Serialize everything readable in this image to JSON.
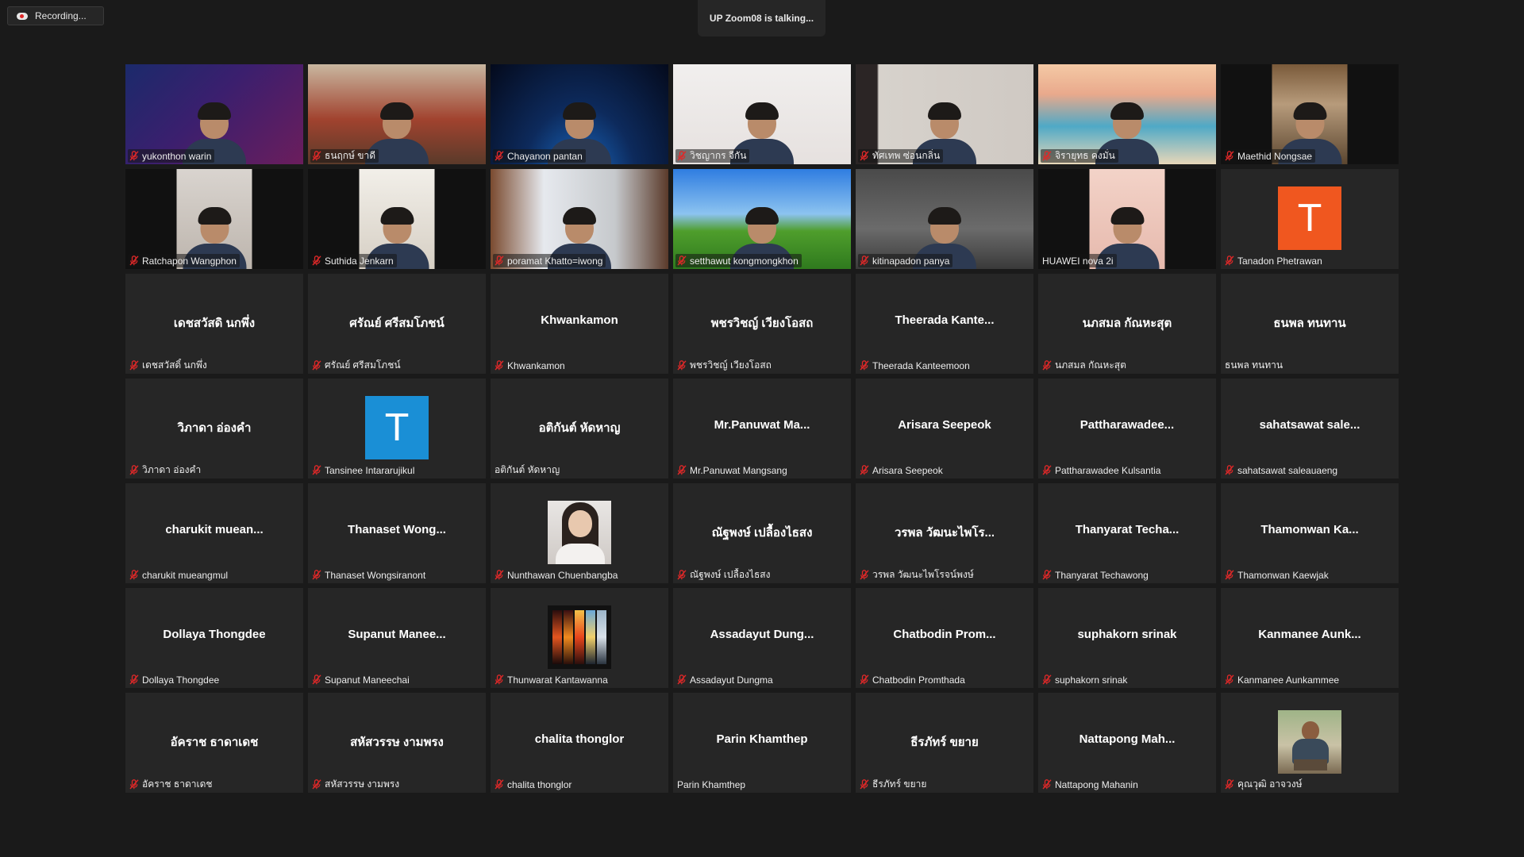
{
  "recording": {
    "label": "Recording..."
  },
  "talking": {
    "text": "UP Zoom08 is talking..."
  },
  "colors": {
    "tile_bg": "#262626",
    "page_bg": "#1a1a1a",
    "mute_red": "#e02828",
    "avatar_orange": "#f0571f",
    "avatar_blue": "#1a8fd6"
  },
  "participants": [
    {
      "name": "yukonthon warin",
      "muted": true,
      "kind": "video",
      "scene": "ctf"
    },
    {
      "name": "ธนฤกษ์ ขาดี",
      "muted": true,
      "kind": "video",
      "scene": "room-red"
    },
    {
      "name": "Chayanon pantan",
      "muted": true,
      "kind": "video",
      "scene": "space"
    },
    {
      "name": "วิชญากร จีกัน",
      "muted": true,
      "kind": "video",
      "scene": "white-room"
    },
    {
      "name": "ทัศเทพ ซ่อนกลิ่น",
      "muted": true,
      "kind": "video",
      "scene": "bright-room"
    },
    {
      "name": "จิรายุทธ คงมั่น",
      "muted": true,
      "kind": "video",
      "scene": "beach"
    },
    {
      "name": "Maethid Nongsae",
      "muted": true,
      "kind": "video",
      "scene": "portrait-wood"
    },
    {
      "name": "Ratchapon Wangphon",
      "muted": true,
      "kind": "video",
      "scene": "portrait-dim"
    },
    {
      "name": "Suthida Jenkarn",
      "muted": true,
      "kind": "video",
      "scene": "portrait-girl"
    },
    {
      "name": "poramat Khatto=iwong",
      "muted": true,
      "kind": "video",
      "scene": "window-room"
    },
    {
      "name": "setthawut kongmongkhon",
      "muted": true,
      "kind": "video",
      "scene": "xp-field"
    },
    {
      "name": "kitinapadon panya",
      "muted": true,
      "kind": "video",
      "scene": "gray-room"
    },
    {
      "name": "HUAWEI nova 2i",
      "muted": false,
      "kind": "video",
      "scene": "portrait-pink"
    },
    {
      "name": "Tanadon Phetrawan",
      "muted": true,
      "kind": "avatar",
      "letter": "T",
      "color": "#f0571f"
    },
    {
      "name": "เดชสวัสดิ์ นกพึ่ง",
      "display": "เดชสวัสดิ นกพึ่ง",
      "muted": true,
      "kind": "text"
    },
    {
      "name": "ศรัณย์ ศรีสมโภชน์",
      "display": "ศรัณย์ ศรีสมโภชน์",
      "muted": true,
      "kind": "text"
    },
    {
      "name": "Khwankamon",
      "display": "Khwankamon",
      "muted": true,
      "kind": "text"
    },
    {
      "name": "พชรวิชญ์ เวียงโอสถ",
      "display": "พชรวิชญ์ เวียงโอสถ",
      "muted": true,
      "kind": "text"
    },
    {
      "name": "Theerada Kanteemoon",
      "display": "Theerada  Kante...",
      "muted": true,
      "kind": "text"
    },
    {
      "name": "นภสมล กัณหะสุต",
      "display": "นภสมล กัณหะสุต",
      "muted": true,
      "kind": "text"
    },
    {
      "name": "ธนพล ทนทาน",
      "display": "ธนพล ทนทาน",
      "muted": false,
      "kind": "text"
    },
    {
      "name": "วิภาดา อ่องคำ",
      "display": "วิภาดา อ่องคำ",
      "muted": true,
      "kind": "text"
    },
    {
      "name": "Tansinee Intararujikul",
      "muted": true,
      "kind": "avatar",
      "letter": "T",
      "color": "#1a8fd6"
    },
    {
      "name": "อติกันต์ หัดหาญ",
      "display": "อติกันต์ หัดหาญ",
      "muted": false,
      "kind": "text"
    },
    {
      "name": "Mr.Panuwat Mangsang",
      "display": "Mr.Panuwat  Ma...",
      "muted": true,
      "kind": "text"
    },
    {
      "name": "Arisara Seepeok",
      "display": "Arisara Seepeok",
      "muted": true,
      "kind": "text"
    },
    {
      "name": "Pattharawadee Kulsantia",
      "display": "Pattharawadee...",
      "muted": true,
      "kind": "text"
    },
    {
      "name": "sahatsawat saleauaeng",
      "display": "sahatsawat  sale...",
      "muted": true,
      "kind": "text"
    },
    {
      "name": "charukit mueangmul",
      "display": "charukit  muean...",
      "muted": true,
      "kind": "text"
    },
    {
      "name": "Thanaset Wongsiranont",
      "display": "Thanaset  Wong...",
      "muted": true,
      "kind": "text"
    },
    {
      "name": "Nunthawan Chuenbangba",
      "muted": true,
      "kind": "photo",
      "photo": "girl"
    },
    {
      "name": "ณัฐพงษ์ เปลื้องไธสง",
      "display": "ณัฐพงษ์ เปลื้องไธสง",
      "muted": true,
      "kind": "text"
    },
    {
      "name": "วรพล วัฒนะไพโรจน์พงษ์",
      "display": "วรพล  วัฒนะไพโร...",
      "muted": true,
      "kind": "text"
    },
    {
      "name": "Thanyarat Techawong",
      "display": "Thanyarat  Techa...",
      "muted": true,
      "kind": "text"
    },
    {
      "name": "Thamonwan Kaewjak",
      "display": "Thamonwan  Ka...",
      "muted": true,
      "kind": "text"
    },
    {
      "name": "Dollaya Thongdee",
      "display": "Dollaya Thongdee",
      "muted": true,
      "kind": "text"
    },
    {
      "name": "Supanut Maneechai",
      "display": "Supanut  Manee...",
      "muted": true,
      "kind": "text"
    },
    {
      "name": "Thunwarat Kantawanna",
      "muted": true,
      "kind": "photo",
      "photo": "sunset"
    },
    {
      "name": "Assadayut Dungma",
      "display": "Assadayut  Dung...",
      "muted": true,
      "kind": "text"
    },
    {
      "name": "Chatbodin Promthada",
      "display": "Chatbodin  Prom...",
      "muted": true,
      "kind": "text"
    },
    {
      "name": "suphakorn srinak",
      "display": "suphakorn srinak",
      "muted": true,
      "kind": "text"
    },
    {
      "name": "Kanmanee Aunkammee",
      "display": "Kanmanee  Aunk...",
      "muted": true,
      "kind": "text"
    },
    {
      "name": "อัคราช ธาดาเดช",
      "display": "อัคราช ธาดาเดช",
      "muted": true,
      "kind": "text"
    },
    {
      "name": "สหัสวรรษ งามพรง",
      "display": "สหัสวรรษ งามพรง",
      "muted": true,
      "kind": "text"
    },
    {
      "name": "chalita thonglor",
      "display": "chalita thonglor",
      "muted": true,
      "kind": "text"
    },
    {
      "name": "Parin Khamthep",
      "display": "Parin Khamthep",
      "muted": false,
      "kind": "text"
    },
    {
      "name": "ธีรภัทร์ ขยาย",
      "display": "ธีรภัทร์ ขยาย",
      "muted": true,
      "kind": "text"
    },
    {
      "name": "Nattapong Mahanin",
      "display": "Nattapong  Mah...",
      "muted": true,
      "kind": "text"
    },
    {
      "name": "คุณวุฒิ อาจวงษ์",
      "muted": true,
      "kind": "photo",
      "photo": "man-outdoor"
    }
  ]
}
